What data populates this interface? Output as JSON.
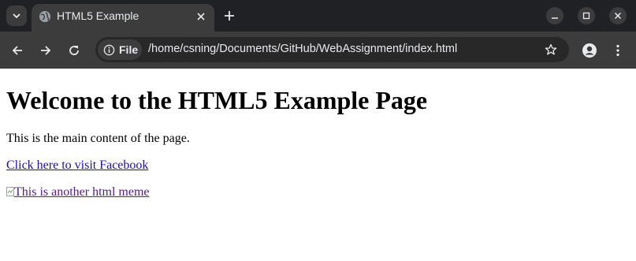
{
  "browser": {
    "tab": {
      "title": "HTML5 Example"
    },
    "address": {
      "scheme_label": "File",
      "url": "/home/csning/Documents/GitHub/WebAssignment/index.html"
    }
  },
  "page": {
    "heading": "Welcome to the HTML5 Example Page",
    "paragraph": "This is the main content of the page.",
    "link_text": "Click here to visit Facebook",
    "image_alt": "This is another html meme"
  },
  "colors": {
    "tabstrip_bg": "#202124",
    "toolbar_bg": "#3c3c3c",
    "omnibox_bg": "#282828",
    "link": "#1a0dab",
    "visited_link": "#551a8b"
  }
}
